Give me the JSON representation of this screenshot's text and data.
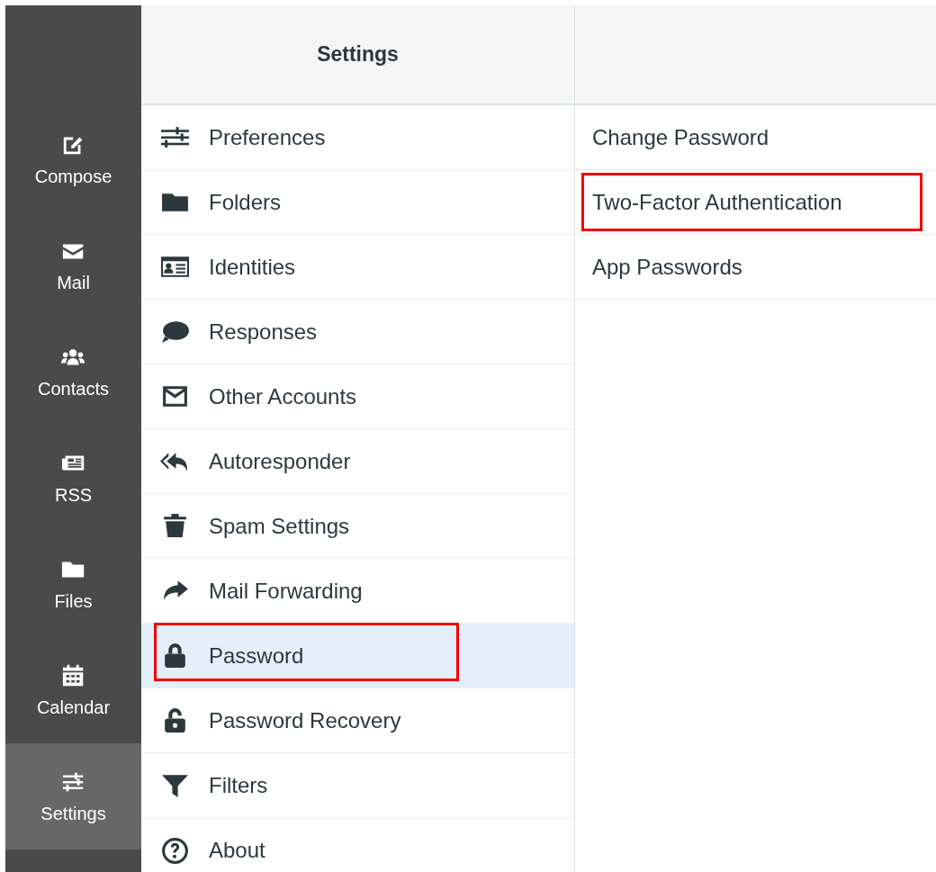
{
  "nav": [
    {
      "label": "Compose",
      "kind": "compose",
      "selected": false
    },
    {
      "label": "Mail",
      "kind": "mail",
      "selected": false
    },
    {
      "label": "Contacts",
      "kind": "contacts",
      "selected": false
    },
    {
      "label": "RSS",
      "kind": "rss",
      "selected": false
    },
    {
      "label": "Files",
      "kind": "files",
      "selected": false
    },
    {
      "label": "Calendar",
      "kind": "calendar",
      "selected": false
    },
    {
      "label": "Settings",
      "kind": "settings",
      "selected": true
    }
  ],
  "settings": {
    "title": "Settings",
    "items": [
      {
        "label": "Preferences",
        "kind": "sliders",
        "selected": false,
        "highlighted": false
      },
      {
        "label": "Folders",
        "kind": "folder",
        "selected": false,
        "highlighted": false
      },
      {
        "label": "Identities",
        "kind": "idcard",
        "selected": false,
        "highlighted": false
      },
      {
        "label": "Responses",
        "kind": "bubble",
        "selected": false,
        "highlighted": false
      },
      {
        "label": "Other Accounts",
        "kind": "envelope",
        "selected": false,
        "highlighted": false
      },
      {
        "label": "Autoresponder",
        "kind": "replyall",
        "selected": false,
        "highlighted": false
      },
      {
        "label": "Spam Settings",
        "kind": "trash",
        "selected": false,
        "highlighted": false
      },
      {
        "label": "Mail Forwarding",
        "kind": "share",
        "selected": false,
        "highlighted": false
      },
      {
        "label": "Password",
        "kind": "lock",
        "selected": true,
        "highlighted": true
      },
      {
        "label": "Password Recovery",
        "kind": "unlock",
        "selected": false,
        "highlighted": false
      },
      {
        "label": "Filters",
        "kind": "filter",
        "selected": false,
        "highlighted": false
      },
      {
        "label": "About",
        "kind": "question",
        "selected": false,
        "highlighted": false
      }
    ]
  },
  "password_options": [
    {
      "label": "Change Password",
      "selected": false,
      "highlighted": false
    },
    {
      "label": "Two-Factor Authentication",
      "selected": false,
      "highlighted": true
    },
    {
      "label": "App Passwords",
      "selected": false,
      "highlighted": false
    }
  ]
}
